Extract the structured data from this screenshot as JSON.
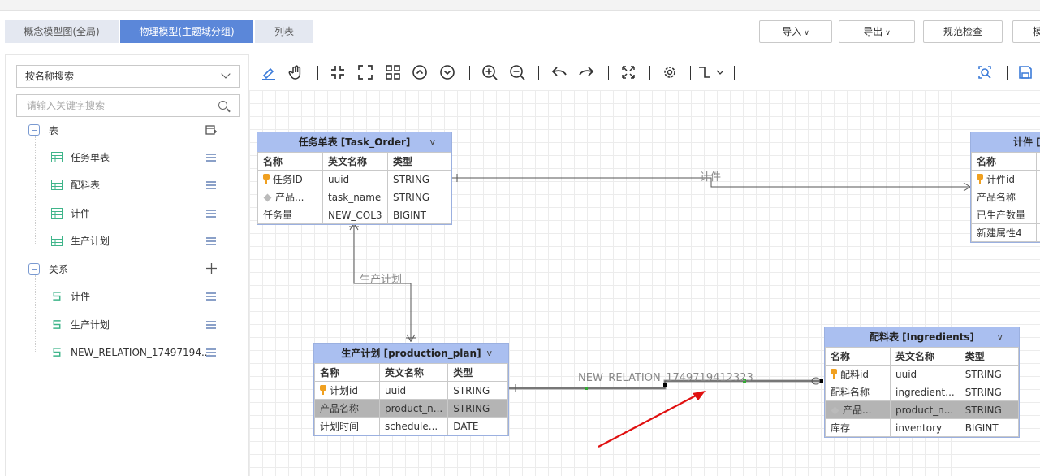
{
  "tabs": [
    {
      "label": "概念模型图(全局)"
    },
    {
      "label": "物理模型(主题域分组)"
    },
    {
      "label": "列表"
    }
  ],
  "top_buttons": {
    "import": "导入",
    "export": "导出",
    "check": "规范检查",
    "partial": "模"
  },
  "sidebar": {
    "search_mode": "按名称搜索",
    "search_placeholder": "请输入关键字搜索",
    "tables_group": "表",
    "tables": [
      {
        "label": "任务单表"
      },
      {
        "label": "配料表"
      },
      {
        "label": "计件"
      },
      {
        "label": "生产计划"
      }
    ],
    "relations_group": "关系",
    "relations": [
      {
        "label": "计件"
      },
      {
        "label": "生产计划"
      },
      {
        "label": "NEW_RELATION_17497194..."
      }
    ]
  },
  "entities": {
    "task_order": {
      "title": "任务单表 [Task_Order]",
      "toggle": "v",
      "headers": [
        "名称",
        "英文名称",
        "类型"
      ],
      "rows": [
        [
          "任务ID",
          "uuid",
          "STRING"
        ],
        [
          "产品...",
          "task_name",
          "STRING"
        ],
        [
          "任务量",
          "NEW_COL3",
          "BIGINT"
        ]
      ]
    },
    "piece": {
      "title": "计件 [",
      "headers": [
        "名称"
      ],
      "rows": [
        [
          "计件id"
        ],
        [
          "产品名称"
        ],
        [
          "已生产数量"
        ],
        [
          "新建属性4"
        ]
      ]
    },
    "production_plan": {
      "title": "生产计划 [production_plan]",
      "toggle": "v",
      "headers": [
        "名称",
        "英文名称",
        "类型"
      ],
      "rows": [
        [
          "计划id",
          "uuid",
          "STRING"
        ],
        [
          "产品名称",
          "product_n...",
          "STRING"
        ],
        [
          "计划时间",
          "schedule...",
          "DATE"
        ]
      ]
    },
    "ingredients": {
      "title": "配料表 [Ingredients]",
      "toggle": "v",
      "headers": [
        "名称",
        "英文名称",
        "类型"
      ],
      "rows": [
        [
          "配料id",
          "uuid",
          "STRING"
        ],
        [
          "配料名称",
          "ingredient...",
          "STRING"
        ],
        [
          "产品...",
          "product_n...",
          "STRING"
        ],
        [
          "库存",
          "inventory",
          "BIGINT"
        ]
      ]
    }
  },
  "relation_labels": {
    "piece": "计件",
    "plan": "生产计划",
    "new_relation": "NEW_RELATION_1749719412323"
  },
  "colors": {
    "tab_active": "#5b87d9",
    "entity_header": "#aabff0",
    "arrow": "#e01010"
  }
}
